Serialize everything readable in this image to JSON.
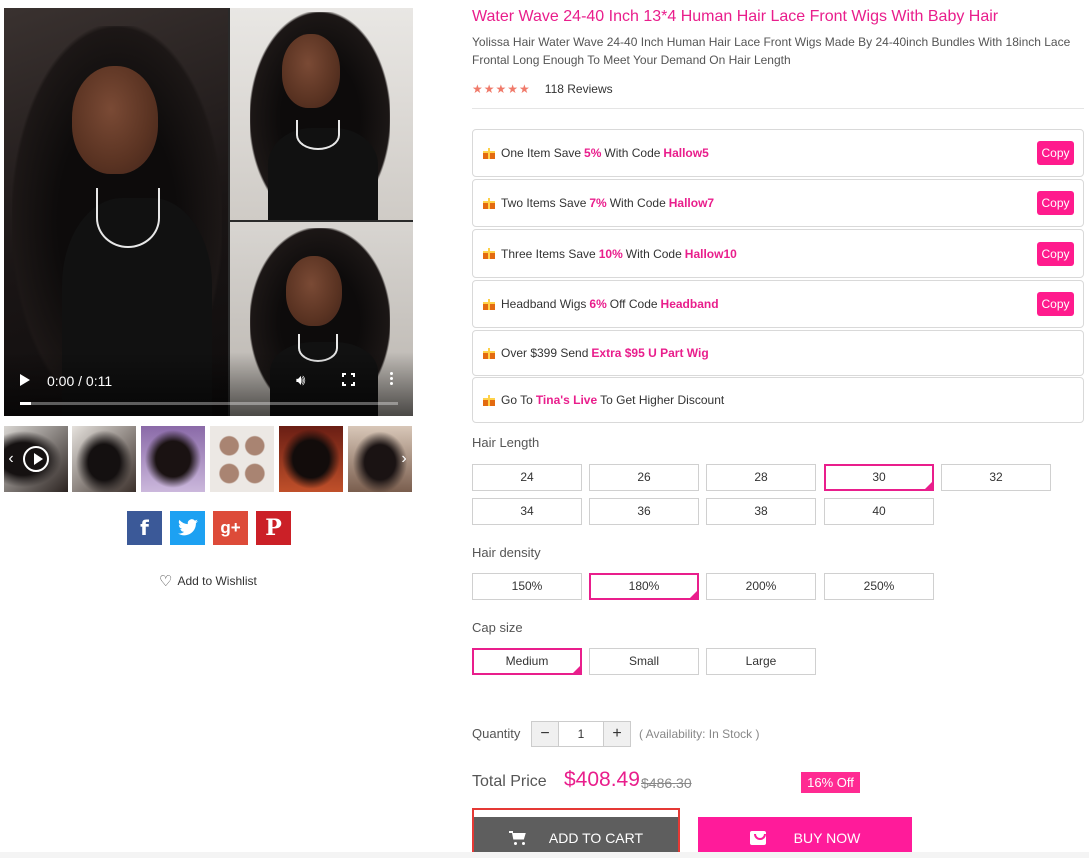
{
  "product": {
    "title": "Water Wave 24-40 Inch 13*4 Human Hair Lace Front Wigs With Baby Hair",
    "subtitle": "Yolissa Hair Water Wave 24-40 Inch Human Hair Lace Front Wigs Made By 24-40inch Bundles With 18inch Lace Frontal Long Enough To Meet Your Demand On Hair Length",
    "rating_stars": "★★★★★",
    "rating_value": 5,
    "reviews": "118 Reviews"
  },
  "video": {
    "time": "0:00 / 0:11",
    "progress": 0.03,
    "play_icon": "play-icon",
    "volume_icon": "volume-icon",
    "fullscreen_icon": "fullscreen-icon",
    "more_icon": "more-vert-icon"
  },
  "gallery": {
    "thumb_count": 6,
    "prev_arrow": "‹",
    "next_arrow": "›"
  },
  "social": {
    "facebook": "f",
    "twitter": "t",
    "googleplus": "g+",
    "pinterest": "P"
  },
  "wishlist": {
    "icon": "♡",
    "label": "Add to Wishlist"
  },
  "coupons": [
    {
      "pre": "One Item Save",
      "pct": "5%",
      "mid": "With Code",
      "code": "Hallow5",
      "copy": "Copy"
    },
    {
      "pre": "Two Items Save",
      "pct": "7%",
      "mid": "With Code",
      "code": "Hallow7",
      "copy": "Copy"
    },
    {
      "pre": "Three Items Save",
      "pct": "10%",
      "mid": "With Code",
      "code": "Hallow10",
      "copy": "Copy"
    },
    {
      "pre": "Headband Wigs",
      "pct": "6%",
      "mid": "Off Code",
      "code": "Headband",
      "copy": "Copy"
    }
  ],
  "promos": [
    {
      "pre": "Over $399 Send",
      "hl": "Extra $95 U Part Wig",
      "post": ""
    },
    {
      "pre": "Go To",
      "hl": "Tina's Live",
      "post": "To Get Higher Discount"
    }
  ],
  "options": {
    "hair_length": {
      "label": "Hair Length",
      "values": [
        "24",
        "26",
        "28",
        "30",
        "32",
        "34",
        "36",
        "38",
        "40"
      ],
      "selected": "30"
    },
    "hair_density": {
      "label": "Hair density",
      "values": [
        "150%",
        "180%",
        "200%",
        "250%"
      ],
      "selected": "180%"
    },
    "cap_size": {
      "label": "Cap size",
      "values": [
        "Medium",
        "Small",
        "Large"
      ],
      "selected": "Medium"
    }
  },
  "quantity": {
    "label": "Quantity",
    "minus": "−",
    "plus": "+",
    "value": "1",
    "availability": "( Availability: In Stock )"
  },
  "price": {
    "label": "Total Price",
    "current": "$408.49",
    "original": "$486.30",
    "discount": "16% Off"
  },
  "actions": {
    "add_to_cart": "ADD TO CART",
    "buy_now": "BUY NOW"
  },
  "colors": {
    "accent": "#e91e8c",
    "button_pink": "#ff1b9a",
    "cart_gray": "#5e5e5e",
    "facebook": "#3b5998",
    "twitter": "#1da1f2",
    "googleplus": "#dd4b39",
    "pinterest": "#cb2027"
  }
}
